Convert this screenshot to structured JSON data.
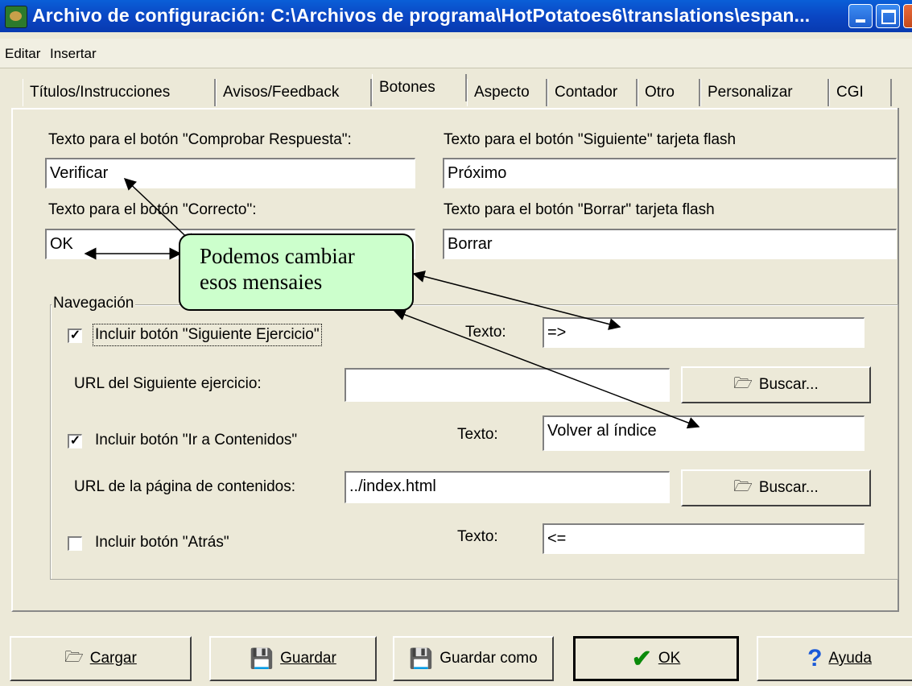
{
  "window": {
    "title": "Archivo de configuración: C:\\Archivos de programa\\HotPotatoes6\\translations\\espan..."
  },
  "menu": {
    "items": [
      "Editar",
      "Insertar"
    ]
  },
  "tabs": [
    {
      "label": "Títulos/Instrucciones"
    },
    {
      "label": "Avisos/Feedback"
    },
    {
      "label": "Botones",
      "active": true
    },
    {
      "label": "Aspecto"
    },
    {
      "label": "Contador"
    },
    {
      "label": "Otro"
    },
    {
      "label": "Personalizar"
    },
    {
      "label": "CGI"
    }
  ],
  "buttons_tab": {
    "check_label": "Texto para el botón \"Comprobar Respuesta\":",
    "check_value": "Verificar",
    "correct_label": "Texto para el botón \"Correcto\":",
    "correct_value": "OK",
    "next_flash_label": "Texto para el botón \"Siguiente\" tarjeta flash",
    "next_flash_value": "Próximo",
    "delete_flash_label": "Texto para el botón \"Borrar\" tarjeta flash",
    "delete_flash_value": "Borrar"
  },
  "navigation": {
    "legend": "Navegación",
    "next_exercise": {
      "checkbox_label": "Incluir botón \"Siguiente Ejercicio\"",
      "checked": true,
      "text_label": "Texto:",
      "text_value": "=>",
      "url_label": "URL del Siguiente ejercicio:",
      "url_value": "",
      "browse_label": "Buscar..."
    },
    "contents": {
      "checkbox_label": "Incluir botón \"Ir a Contenidos\"",
      "checked": true,
      "text_label": "Texto:",
      "text_value": "Volver al índice",
      "url_label": "URL de la página de contenidos:",
      "url_value": "../index.html",
      "browse_label": "Buscar..."
    },
    "back": {
      "checkbox_label": "Incluir botón \"Atrás\"",
      "checked": false,
      "text_label": "Texto:",
      "text_value": "<="
    }
  },
  "callout": {
    "line1": "Podemos cambiar",
    "line2": "esos mensaies"
  },
  "footer": {
    "load": "Cargar",
    "save": "Guardar",
    "save_as": "Guardar como",
    "ok": "OK",
    "help": "Ayuda"
  },
  "colors": {
    "titlebar": "#0a4fd0",
    "dialog": "#ece9d8",
    "callout": "#ccffcc"
  }
}
